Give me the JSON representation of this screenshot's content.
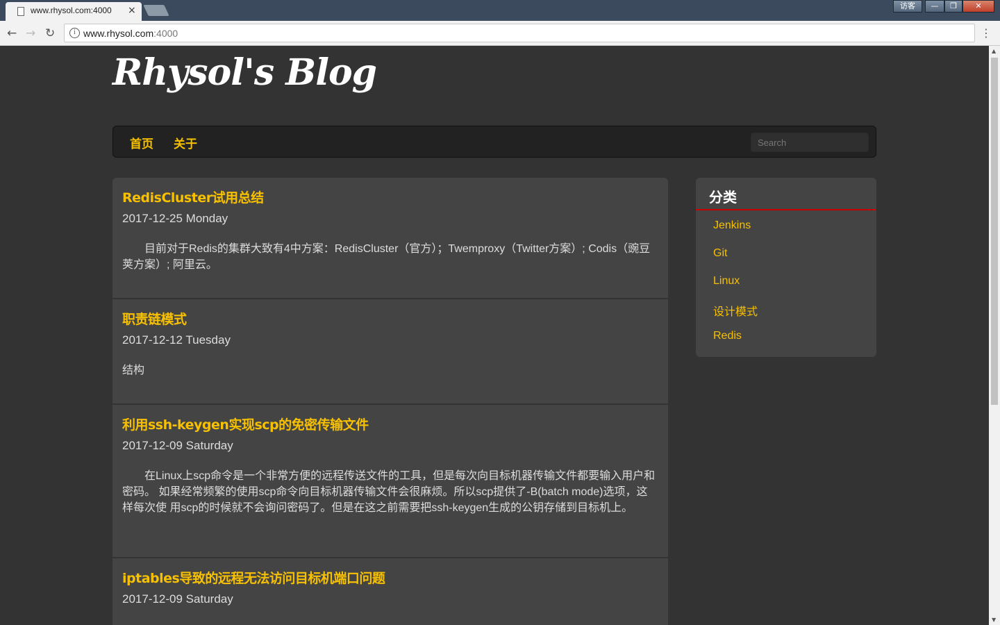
{
  "browser": {
    "tab_title": "www.rhysol.com:4000",
    "tab_close": "×",
    "window_guest": "访客",
    "url_host": "www.rhysol.com",
    "url_port": ":4000",
    "back": "←",
    "forward": "→",
    "reload": "↻",
    "menu": "⋮",
    "info": "i"
  },
  "site": {
    "logo": "Rhysol's Blog"
  },
  "nav": {
    "home": "首页",
    "about": "关于",
    "search_placeholder": "Search"
  },
  "posts": [
    {
      "title": "RedisCluster试用总结",
      "date": "2017-12-25 Monday",
      "excerpt": "　　目前对于Redis的集群大致有4中方案：RedisCluster（官方）；Twemproxy（Twitter方案）; Codis（豌豆荚方案）; 阿里云。"
    },
    {
      "title": "职责链模式",
      "date": "2017-12-12 Tuesday",
      "excerpt": "结构"
    },
    {
      "title": "利用ssh-keygen实现scp的免密传输文件",
      "date": "2017-12-09 Saturday",
      "excerpt": "　　在Linux上scp命令是一个非常方便的远程传送文件的工具，但是每次向目标机器传输文件都要输入用户和密码。 如果经常频繁的使用scp命令向目标机器传输文件会很麻烦。所以scp提供了-B(batch mode)选项，这样每次使 用scp的时候就不会询问密码了。但是在这之前需要把ssh-keygen生成的公钥存储到目标机上。"
    },
    {
      "title": "iptables导致的远程无法访问目标机端口问题",
      "date": "2017-12-09 Saturday",
      "excerpt": ""
    }
  ],
  "sidebar": {
    "title": "分类",
    "categories": [
      "Jenkins",
      "Git",
      "Linux",
      "设计模式",
      "Redis"
    ]
  }
}
